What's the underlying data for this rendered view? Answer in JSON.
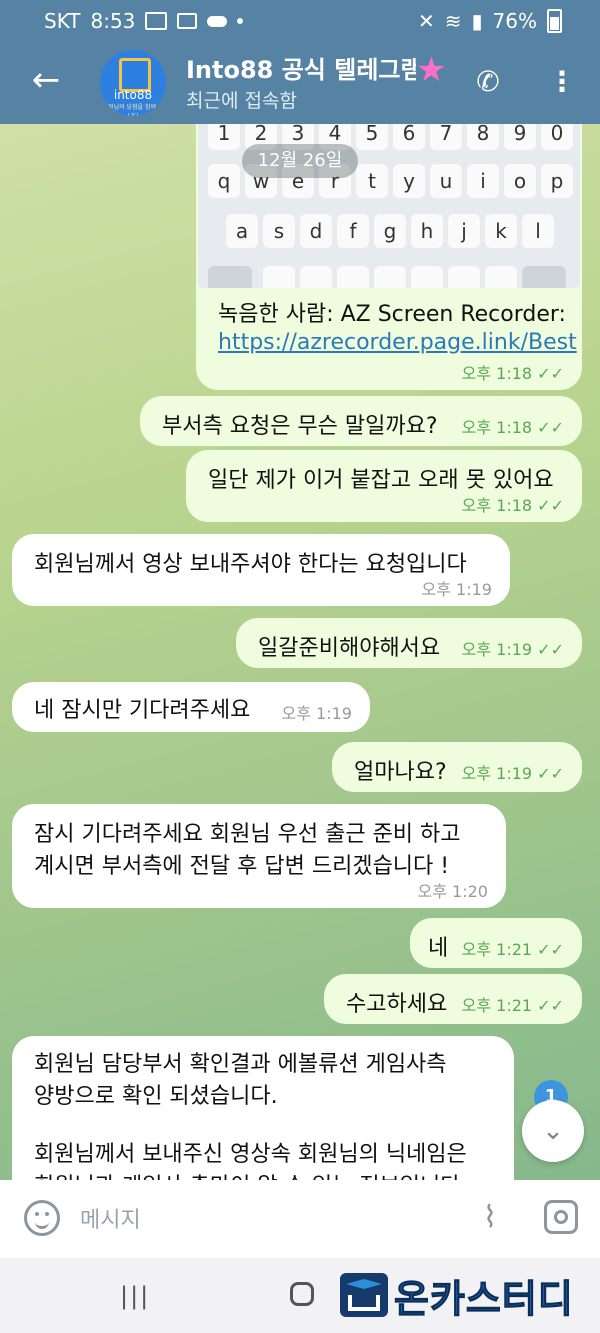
{
  "status_bar": {
    "carrier": "SKT",
    "time": "8:53",
    "battery": "76%"
  },
  "header": {
    "title": "Into88 공식 텔레그램",
    "subtitle": "최근에 접속함",
    "avatar_text": "into88",
    "avatar_subtext": "회원님의 당첨을 함께 합니다"
  },
  "date_badge": "12월 26일",
  "keyboard": {
    "row1": [
      "1",
      "2",
      "3",
      "4",
      "5",
      "6",
      "7",
      "8",
      "9",
      "0"
    ],
    "row2": [
      "q",
      "w",
      "e",
      "r",
      "t",
      "y",
      "u",
      "i",
      "o",
      "p"
    ],
    "row3": [
      "a",
      "s",
      "d",
      "f",
      "g",
      "h",
      "j",
      "k",
      "l"
    ]
  },
  "messages": [
    {
      "dir": "out",
      "lines": [
        "녹음한 사람: AZ Screen Recorder:"
      ],
      "link": "https://azrecorder.page.link/Best",
      "time": "오후 1:18"
    },
    {
      "dir": "out",
      "lines": [
        "부서측 요청은 무슨 말일까요?"
      ],
      "time": "오후 1:18"
    },
    {
      "dir": "out",
      "lines": [
        "일단 제가 이거 붙잡고 오래 못 있어요"
      ],
      "time": "오후 1:18"
    },
    {
      "dir": "in",
      "lines": [
        "회원님께서 영상 보내주셔야 한다는 요청입니다"
      ],
      "time": "오후 1:19"
    },
    {
      "dir": "out",
      "lines": [
        "일갈준비해야해서요"
      ],
      "time": "오후 1:19"
    },
    {
      "dir": "in",
      "lines": [
        "네 잠시만 기다려주세요"
      ],
      "time": "오후 1:19"
    },
    {
      "dir": "out",
      "lines": [
        "얼마나요?"
      ],
      "time": "오후 1:19"
    },
    {
      "dir": "in",
      "lines": [
        "잠시 기다려주세요 회원님 우선 출근 준비 하고",
        "계시면 부서측에 전달 후 답변 드리겠습니다 !"
      ],
      "time": "오후 1:20"
    },
    {
      "dir": "out",
      "lines": [
        "네"
      ],
      "time": "오후 1:21"
    },
    {
      "dir": "out",
      "lines": [
        "수고하세요"
      ],
      "time": "오후 1:21"
    },
    {
      "dir": "in",
      "lines": [
        "회원님 담당부서 확인결과 에볼류션 게임사측",
        "양방으로 확인 되셨습니다.",
        "",
        "회원님께서 보내주신 영상속 회원님의 닉네임은",
        "회원님과 게임사 측만이 알 수 있는 정보입니다"
      ]
    }
  ],
  "unread_count": "1",
  "composer": {
    "placeholder": "메시지"
  },
  "watermark": "온카스터디",
  "icons": {
    "back": "arrow-left-icon",
    "phone": "phone-icon",
    "more": "more-vertical-icon",
    "emoji": "emoji-icon",
    "attach": "paperclip-icon",
    "camera": "camera-icon",
    "scroll_down": "chevron-down-icon"
  },
  "colors": {
    "header": "#5682a3",
    "outgoing_bubble": "#effdde",
    "incoming_bubble": "#ffffff",
    "time_outgoing": "#5aa855",
    "unread_badge": "#3d95e0"
  }
}
